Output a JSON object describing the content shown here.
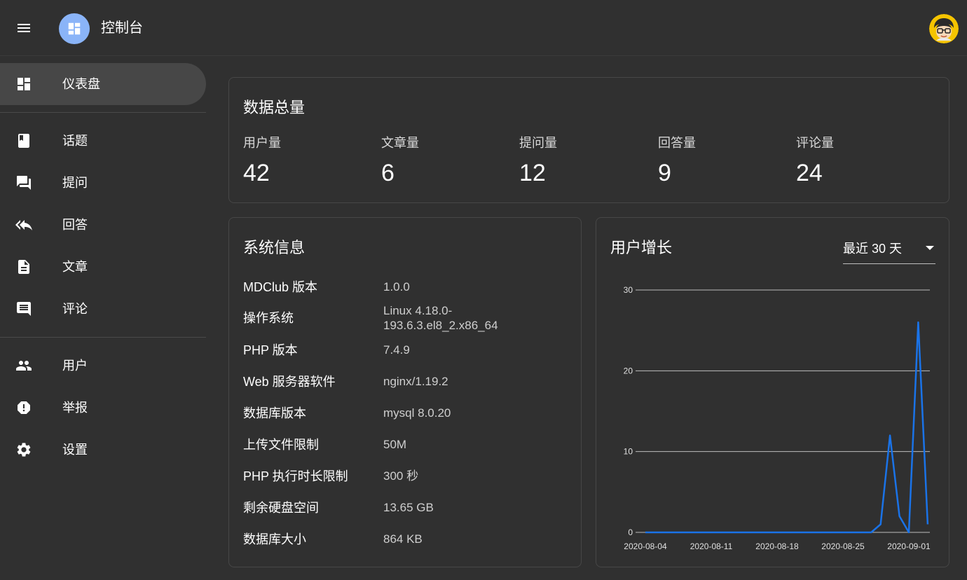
{
  "appbar": {
    "title": "控制台",
    "menu_icon": "menu-icon",
    "logo_icon": "dashboard-icon",
    "avatar_icon": "user-avatar"
  },
  "sidebar": {
    "items": [
      {
        "label": "仪表盘",
        "icon": "dashboard-icon",
        "active": true
      },
      {
        "label": "话题",
        "icon": "book-icon"
      },
      {
        "label": "提问",
        "icon": "forum-icon"
      },
      {
        "label": "回答",
        "icon": "reply-all-icon"
      },
      {
        "label": "文章",
        "icon": "description-icon"
      },
      {
        "label": "评论",
        "icon": "comment-icon"
      },
      {
        "label": "用户",
        "icon": "people-icon"
      },
      {
        "label": "举报",
        "icon": "report-icon"
      },
      {
        "label": "设置",
        "icon": "settings-icon"
      }
    ]
  },
  "totals": {
    "title": "数据总量",
    "stats": [
      {
        "label": "用户量",
        "value": "42"
      },
      {
        "label": "文章量",
        "value": "6"
      },
      {
        "label": "提问量",
        "value": "12"
      },
      {
        "label": "回答量",
        "value": "9"
      },
      {
        "label": "评论量",
        "value": "24"
      }
    ]
  },
  "system": {
    "title": "系统信息",
    "rows": [
      {
        "key": "MDClub 版本",
        "value": "1.0.0"
      },
      {
        "key": "操作系统",
        "value": "Linux 4.18.0-193.6.3.el8_2.x86_64"
      },
      {
        "key": "PHP 版本",
        "value": "7.4.9"
      },
      {
        "key": "Web 服务器软件",
        "value": "nginx/1.19.2"
      },
      {
        "key": "数据库版本",
        "value": "mysql 8.0.20"
      },
      {
        "key": "上传文件限制",
        "value": "50M"
      },
      {
        "key": "PHP 执行时长限制",
        "value": "300 秒"
      },
      {
        "key": "剩余硬盘空间",
        "value": "13.65 GB"
      },
      {
        "key": "数据库大小",
        "value": "864 KB"
      }
    ]
  },
  "growth": {
    "title": "用户增长",
    "range": "最近 30 天"
  },
  "chart_data": {
    "type": "line",
    "x": [
      "2020-08-04",
      "2020-08-05",
      "2020-08-06",
      "2020-08-07",
      "2020-08-08",
      "2020-08-09",
      "2020-08-10",
      "2020-08-11",
      "2020-08-12",
      "2020-08-13",
      "2020-08-14",
      "2020-08-15",
      "2020-08-16",
      "2020-08-17",
      "2020-08-18",
      "2020-08-19",
      "2020-08-20",
      "2020-08-21",
      "2020-08-22",
      "2020-08-23",
      "2020-08-24",
      "2020-08-25",
      "2020-08-26",
      "2020-08-27",
      "2020-08-28",
      "2020-08-29",
      "2020-08-30",
      "2020-08-31",
      "2020-09-01",
      "2020-09-02"
    ],
    "x_ticks": [
      "2020-08-04",
      "2020-08-11",
      "2020-08-18",
      "2020-08-25",
      "2020-09-01"
    ],
    "series": [
      {
        "values": [
          0,
          0,
          0,
          0,
          0,
          0,
          0,
          0,
          0,
          0,
          0,
          0,
          0,
          0,
          0,
          0,
          0,
          0,
          0,
          0,
          0,
          0,
          0,
          0,
          0,
          1,
          12,
          2,
          0,
          26,
          1
        ]
      }
    ],
    "y_ticks": [
      0,
      10,
      20,
      30
    ],
    "ylim": [
      0,
      30
    ],
    "grid": true,
    "line_color": "#1a73e8",
    "grid_color": "#bdbdbd"
  }
}
